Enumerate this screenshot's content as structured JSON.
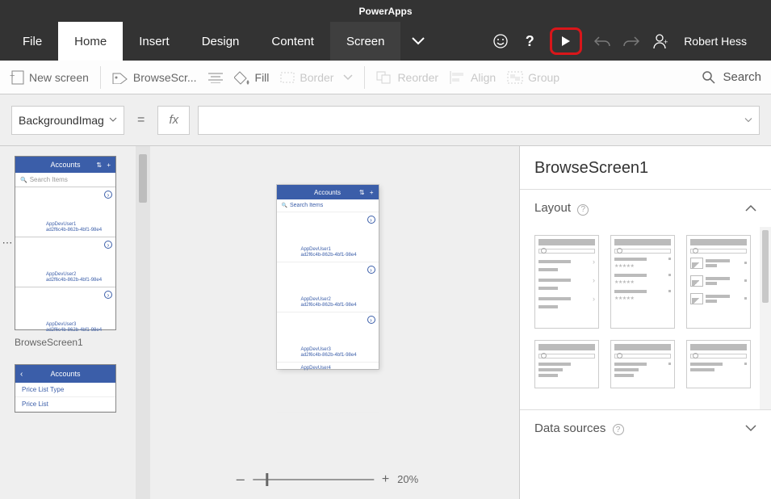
{
  "app": {
    "title": "PowerApps"
  },
  "tabs": {
    "file": "File",
    "home": "Home",
    "insert": "Insert",
    "design": "Design",
    "content": "Content",
    "screen": "Screen"
  },
  "user": {
    "name": "Robert Hess"
  },
  "ribbon": {
    "new_screen": "New screen",
    "browse_scr": "BrowseScr...",
    "fill": "Fill",
    "border": "Border",
    "reorder": "Reorder",
    "align": "Align",
    "group": "Group",
    "search": "Search"
  },
  "formula": {
    "property": "BackgroundImag",
    "equals": "=",
    "fx": "fx"
  },
  "leftnav": {
    "thumb1_title": "Accounts",
    "thumb1_search": "Search Items",
    "thumb1_label": "BrowseScreen1",
    "thumb2_title": "Accounts",
    "thumb2_line1": "Price List Type",
    "thumb2_line2": "Price List"
  },
  "canvas": {
    "title": "Accounts",
    "search": "Search Items"
  },
  "zoom": {
    "minus": "–",
    "plus": "+",
    "value": "20%"
  },
  "rightpanel": {
    "title": "BrowseScreen1",
    "section_layout": "Layout",
    "section_datasources": "Data sources"
  }
}
